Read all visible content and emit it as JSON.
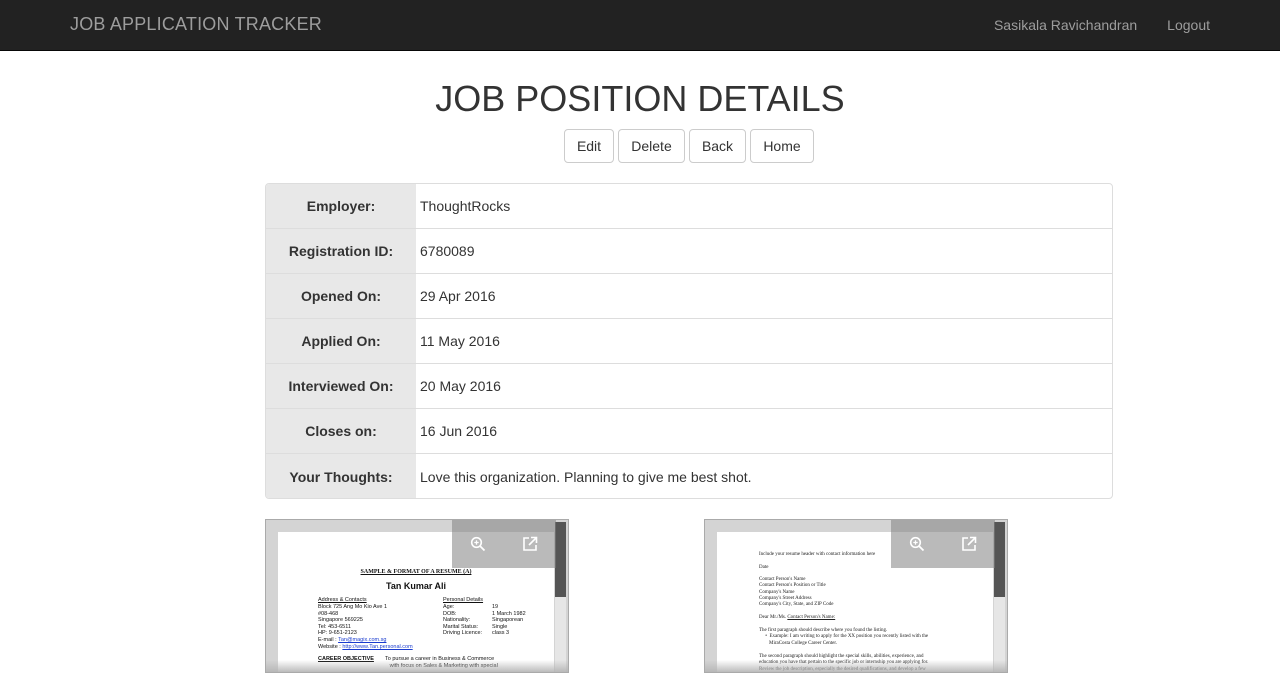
{
  "navbar": {
    "brand": "JOB APPLICATION TRACKER",
    "user": "Sasikala Ravichandran",
    "logout": "Logout"
  },
  "page_title": "JOB POSITION DETAILS",
  "buttons": {
    "edit": "Edit",
    "delete": "Delete",
    "back": "Back",
    "home": "Home"
  },
  "details": [
    {
      "label": "Employer:",
      "value": "ThoughtRocks"
    },
    {
      "label": "Registration ID:",
      "value": "6780089"
    },
    {
      "label": "Opened On:",
      "value": "29 Apr 2016"
    },
    {
      "label": "Applied On:",
      "value": "11 May 2016"
    },
    {
      "label": "Interviewed On:",
      "value": "20 May 2016"
    },
    {
      "label": "Closes on:",
      "value": "16 Jun 2016"
    },
    {
      "label": "Your Thoughts:",
      "value": "Love this organization. Planning to give me best shot."
    }
  ],
  "resume_preview": {
    "title": "SAMPLE & FORMAT OF A RESUME (A)",
    "name": "Tan Kumar Ali",
    "address_heading": "Address & Contacts",
    "address_lines": "Block 725 Ang Mo Kio Ave 1\n#08-468\nSingapore 569225\nTel: 453-6511\nHP: 9-651-2123",
    "email_label": "E-mail : ",
    "email": "Tan@magix.com.sg",
    "website_label": "Website : ",
    "website": "http://www.Tan.personal.com",
    "personal_heading": "Personal Details",
    "personal_keys": "Age:\nDOB:\nNationality:\nMarital Status:\nDriving Licence:",
    "personal_values": "19\n1 March 1982\nSingaporean\nSingle\nclass 3",
    "career_heading": "CAREER OBJECTIVE",
    "career_text": "To pursue a career in Business & Commerce\n   with focus on Sales & Marketing with special"
  },
  "letter_preview": {
    "line1": "Include your resume header with contact information here",
    "date": "Date",
    "address_block": "Contact Person's Name\nContact Person's Position or Title\nCompany's Name\nCompany's Street Address\nCompany's City, State, and ZIP Code",
    "salutation_prefix": "Dear Mr./Ms. ",
    "salutation_name": "Contact Person's Name:",
    "para1": "The first paragraph should describe where you found the listing.\n     •  Example: I am writing to apply for the XX position you recently listed with the\n        MiraCosta College Career Center.",
    "para2": "The second paragraph should highlight the special skills, abilities, experience, and\neducation you have that pertain to the specific job or internship you are applying for.\nReview the job description, especially the desired qualifications, and develop a few"
  },
  "icons": {
    "zoom": "zoom-in-icon",
    "open": "external-link-icon"
  },
  "colors": {
    "navbar_bg": "#222222",
    "navbar_text": "#9d9d9d",
    "label_bg": "#e8e8e8",
    "border": "#dddddd"
  }
}
